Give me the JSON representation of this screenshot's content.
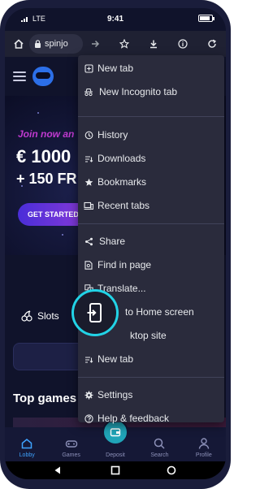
{
  "status": {
    "carrier": "LTE",
    "time": "9:41"
  },
  "toolbar": {
    "url": "spinjo"
  },
  "site": {
    "join_text": "Join now an",
    "headline_1": "€ 1000",
    "headline_2": "+ 150 FR",
    "cta": "GET STARTED",
    "slots_label": "Slots",
    "top_games": "Top games"
  },
  "menu": {
    "new_tab": "New tab",
    "incognito": "New Incognito tab",
    "history": "History",
    "downloads": "Downloads",
    "bookmarks": "Bookmarks",
    "recent_tabs": "Recent tabs",
    "share": "Share",
    "find": "Find in page",
    "translate": "Translate...",
    "add_home": "to Home screen",
    "desktop": "ktop site",
    "new_tab_2": "New tab",
    "settings": "Settings",
    "help": "Help & feedback"
  },
  "nav": {
    "lobby": "Lobby",
    "games": "Games",
    "deposit": "Deposit",
    "search": "Search",
    "profile": "Profile"
  },
  "colors": {
    "accent": "#22d3e6",
    "menu_bg": "#2a2b3c",
    "active_nav": "#3ea3ff"
  }
}
